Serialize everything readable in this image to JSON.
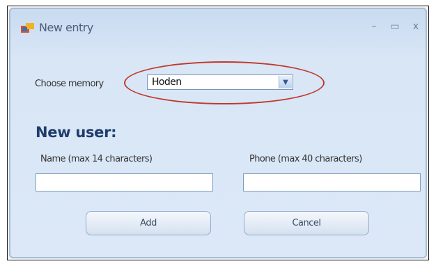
{
  "window": {
    "title": "New entry",
    "controls": {
      "minimize": "–",
      "maximize": "▭",
      "close": "x"
    }
  },
  "memory": {
    "label": "Choose memory",
    "selected": "Hoden"
  },
  "section_heading": "New user:",
  "fields": {
    "name_label": "Name (max 14 characters)",
    "phone_label": "Phone (max 40 characters)",
    "name_value": "",
    "phone_value": ""
  },
  "buttons": {
    "add": "Add",
    "cancel": "Cancel"
  },
  "colors": {
    "highlight": "#c0392b",
    "heading": "#1f3d6c",
    "window_bg": "#dce8f7"
  }
}
